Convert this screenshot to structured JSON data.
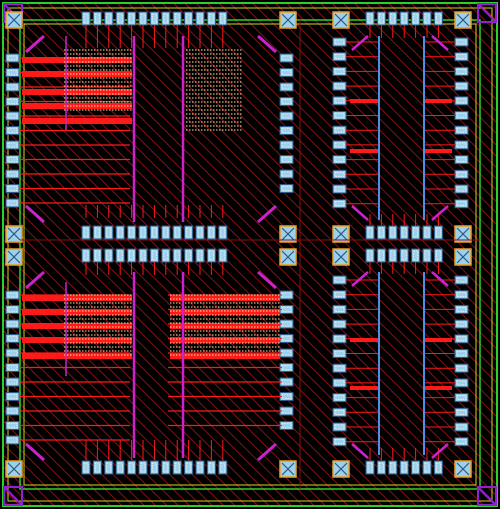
{
  "title": "",
  "colors": {
    "background": "#000000",
    "hatch": "#8a1010",
    "border_green": "#2bd12b",
    "border_yellow": "#d8d020",
    "metal_red": "#ff1a1a",
    "poly_magenta": "#cc22cc",
    "via_blue": "#4a90e8",
    "pad_fill": "#9fd0e8",
    "pad_border": "#2a5a8a",
    "corner_orange": "#e8a020",
    "dots_pale": "#ffe9a8",
    "corner_violet": "#9020d0"
  },
  "layers": [
    "substrate-hatch",
    "metal1-red",
    "poly-magenta",
    "via-blue",
    "io-pads",
    "corner-cells",
    "boundary-green",
    "boundary-yellow"
  ]
}
